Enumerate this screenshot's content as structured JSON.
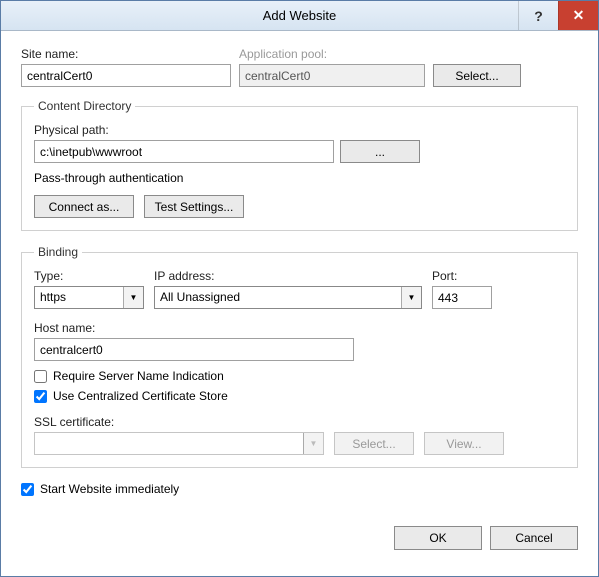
{
  "window": {
    "title": "Add Website"
  },
  "site_name": {
    "label": "Site name:",
    "value": "centralCert0"
  },
  "app_pool": {
    "label": "Application pool:",
    "value": "centralCert0",
    "select_btn": "Select..."
  },
  "content_dir": {
    "legend": "Content Directory",
    "path_label": "Physical path:",
    "path_value": "c:\\inetpub\\wwwroot",
    "browse": "...",
    "passthru": "Pass-through authentication",
    "connect_as": "Connect as...",
    "test_settings": "Test Settings..."
  },
  "binding": {
    "legend": "Binding",
    "type_label": "Type:",
    "type_value": "https",
    "ip_label": "IP address:",
    "ip_value": "All Unassigned",
    "port_label": "Port:",
    "port_value": "443",
    "host_label": "Host name:",
    "host_value": "centralcert0",
    "sni": "Require Server Name Indication",
    "ccs": "Use Centralized Certificate Store",
    "ssl_label": "SSL certificate:",
    "ssl_value": "",
    "ssl_select": "Select...",
    "ssl_view": "View..."
  },
  "start_immediately": "Start Website immediately",
  "footer": {
    "ok": "OK",
    "cancel": "Cancel"
  }
}
